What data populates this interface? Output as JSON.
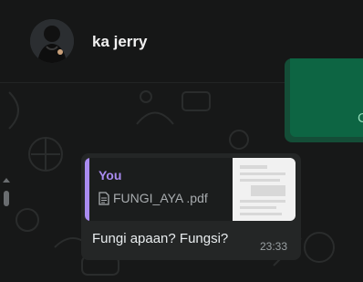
{
  "header": {
    "contact_name": "ka jerry",
    "avatar_icon": "person-avatar-icon"
  },
  "chat": {
    "outgoing_partial_text": "C",
    "incoming": {
      "quote": {
        "author": "You",
        "file_icon": "document-icon",
        "file_name": "FUNGI_AYA .pdf"
      },
      "text": "Fungi apaan? Fungsi?",
      "time": "23:33"
    }
  },
  "colors": {
    "quote_accent": "#a98bf0",
    "outgoing_bubble": "#144d37",
    "incoming_bubble": "#242626"
  }
}
